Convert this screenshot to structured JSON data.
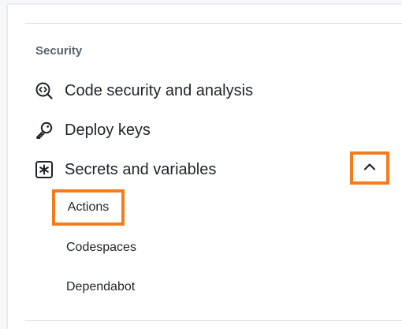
{
  "section": {
    "heading": "Security"
  },
  "items": [
    {
      "label": "Code security and analysis",
      "icon": "codescan-icon"
    },
    {
      "label": "Deploy keys",
      "icon": "key-icon"
    },
    {
      "label": "Secrets and variables",
      "icon": "key-asterisk-icon"
    }
  ],
  "subitems": [
    {
      "label": "Actions"
    },
    {
      "label": "Codespaces"
    },
    {
      "label": "Dependabot"
    }
  ],
  "collapse": {
    "icon": "chevron-up-icon"
  },
  "colors": {
    "highlight": "#f47c1c",
    "text": "#1f2328",
    "muted": "#59636e",
    "divider": "#d8dee4"
  }
}
